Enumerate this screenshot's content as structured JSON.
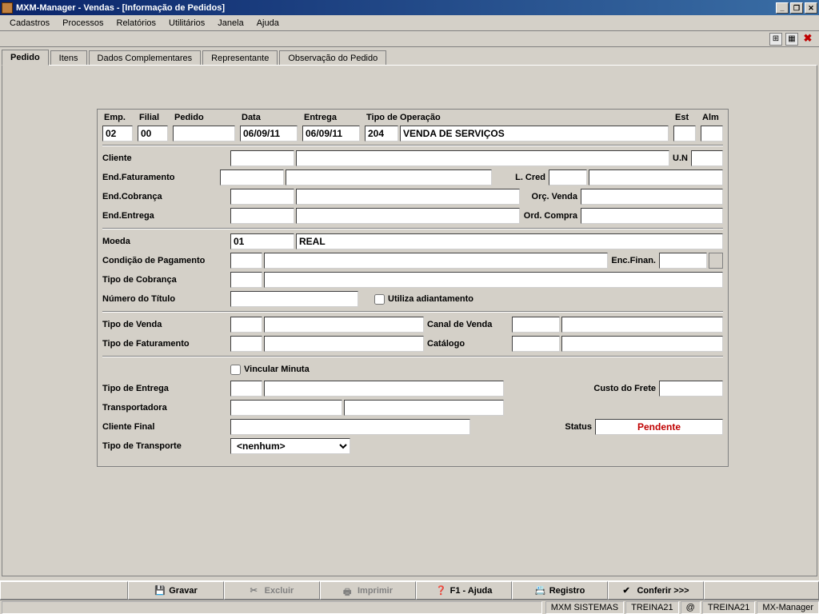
{
  "window": {
    "title": "MXM-Manager - Vendas - [Informação de Pedidos]"
  },
  "menu": {
    "cadastros": "Cadastros",
    "processos": "Processos",
    "relatorios": "Relatórios",
    "utilitarios": "Utilitários",
    "janela": "Janela",
    "ajuda": "Ajuda"
  },
  "tabs": {
    "pedido": "Pedido",
    "itens": "Itens",
    "dados": "Dados Complementares",
    "representante": "Representante",
    "observacao": "Observação do Pedido"
  },
  "headers": {
    "emp": "Emp.",
    "filial": "Filial",
    "pedido": "Pedido",
    "data": "Data",
    "entrega": "Entrega",
    "tipo_op": "Tipo de Operação",
    "est": "Est",
    "alm": "Alm"
  },
  "values": {
    "emp": "02",
    "filial": "00",
    "pedido": "",
    "data": "06/09/11",
    "entrega": "06/09/11",
    "tipo_op_code": "204",
    "tipo_op_desc": "VENDA DE SERVIÇOS",
    "est": "",
    "alm": "",
    "moeda_code": "01",
    "moeda_desc": "REAL",
    "status": "Pendente",
    "transporte": "<nenhum>"
  },
  "labels": {
    "cliente": "Cliente",
    "un": "U.N",
    "end_fat": "End.Faturamento",
    "l_cred": "L. Cred",
    "end_cob": "End.Cobrança",
    "orc_venda": "Orç.  Venda",
    "end_ent": "End.Entrega",
    "ord_compra": "Ord. Compra",
    "moeda": "Moeda",
    "cond_pag": "Condição de Pagamento",
    "enc_finan": "Enc.Finan.",
    "tipo_cob": "Tipo de Cobrança",
    "num_titulo": "Número do Título",
    "utiliza_adiant": "Utiliza adiantamento",
    "tipo_venda": "Tipo de Venda",
    "canal_venda": "Canal de Venda",
    "tipo_fat": "Tipo de Faturamento",
    "catalogo": "Catálogo",
    "vinc_minuta": "Vincular Minuta",
    "tipo_entrega": "Tipo de Entrega",
    "custo_frete": "Custo do Frete",
    "transportadora": "Transportadora",
    "cliente_final": "Cliente Final",
    "status": "Status",
    "tipo_transporte": "Tipo de Transporte"
  },
  "buttons": {
    "gravar": "Gravar",
    "excluir": "Excluir",
    "imprimir": "Imprimir",
    "ajuda": "F1 - Ajuda",
    "registro": "Registro",
    "conferir": "Conferir >>>"
  },
  "status": {
    "company": "MXM SISTEMAS",
    "user1": "TREINA21",
    "at": "@",
    "user2": "TREINA21",
    "app": "MX-Manager"
  }
}
